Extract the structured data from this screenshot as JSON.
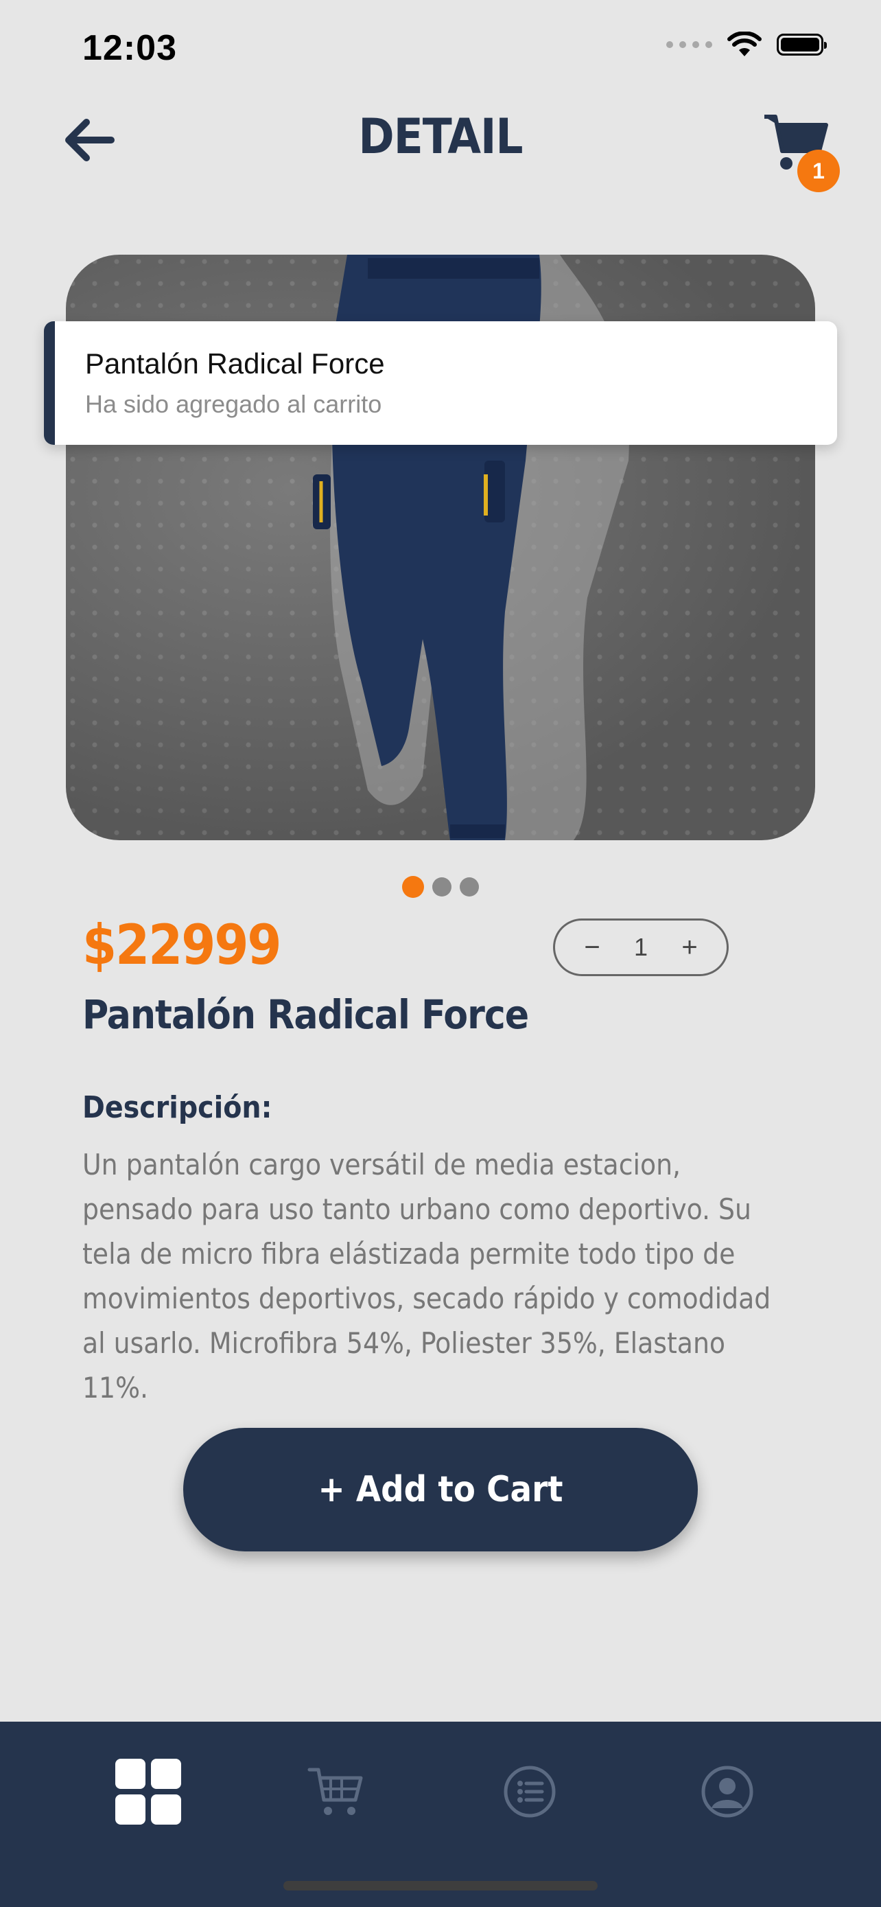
{
  "status_bar": {
    "time": "12:03"
  },
  "header": {
    "title": "DETAIL",
    "cart_count": "1"
  },
  "toast": {
    "title": "Pantalón Radical Force",
    "message": "Ha sido agregado al carrito"
  },
  "carousel": {
    "page_count": 3,
    "active_index": 0
  },
  "product": {
    "price": "$22999",
    "name": "Pantalón Radical Force",
    "quantity": "1",
    "description_label": "Descripción:",
    "description": "Un pantalón cargo versátil de media estacion, pensado para uso tanto urbano como deportivo. Su tela de micro fibra elástizada permite todo tipo de movimientos deportivos, secado rápido y comodidad al usarlo. Microfibra 54%, Poliester 35%, Elastano 11%."
  },
  "actions": {
    "add_to_cart_label": "+ Add to Cart",
    "minus": "−",
    "plus": "+"
  },
  "tabbar": {
    "items": [
      {
        "icon": "grid-icon",
        "active": true
      },
      {
        "icon": "cart-icon",
        "active": false
      },
      {
        "icon": "list-icon",
        "active": false
      },
      {
        "icon": "user-icon",
        "active": false
      }
    ]
  },
  "colors": {
    "primary": "#25344d",
    "accent": "#f57810",
    "background": "#e6e6e6"
  }
}
